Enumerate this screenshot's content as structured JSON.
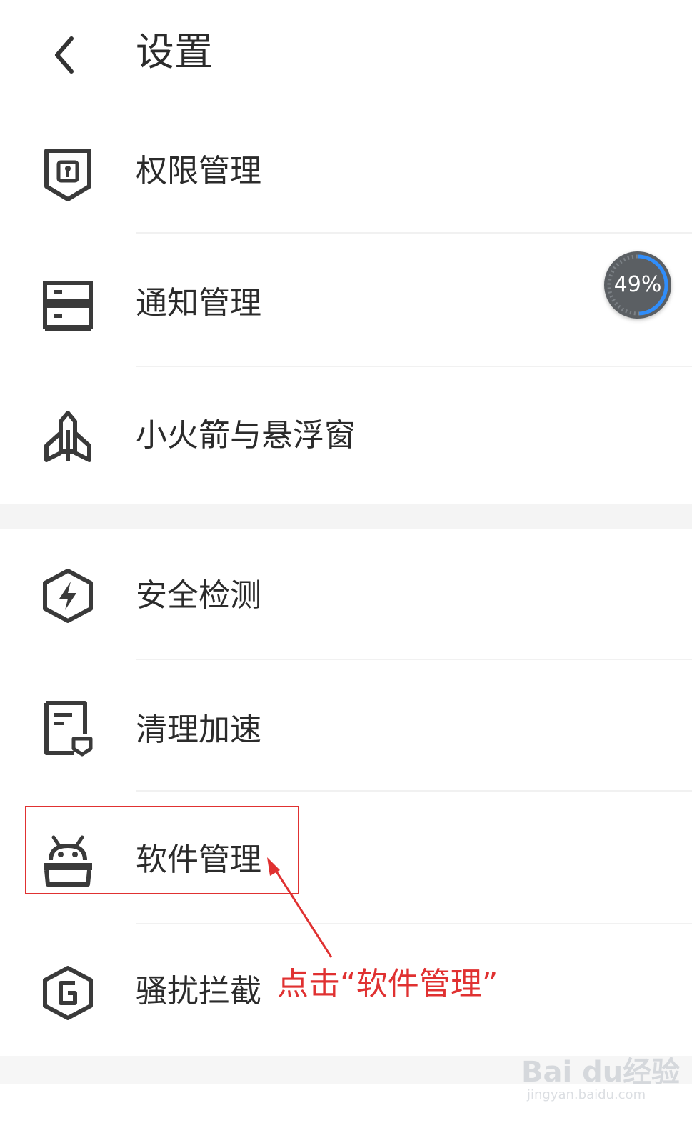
{
  "header": {
    "title": "设置"
  },
  "float_widget": {
    "percent": "49%",
    "progress": 0.49
  },
  "menu": {
    "permission": "权限管理",
    "notification": "通知管理",
    "rocket": "小火箭与悬浮窗",
    "security": "安全检测",
    "cleanup": "清理加速",
    "software": "软件管理",
    "blocking": "骚扰拦截"
  },
  "annotation": {
    "text": "点击“软件管理”",
    "color": "#e03131"
  },
  "watermark": {
    "main": "Bai du经验",
    "sub": "jingyan.baidu.com"
  },
  "colors": {
    "icon": "#3a3a3a",
    "accent_red": "#e03131",
    "widget_bg": "#5b5f63",
    "widget_ring": "#2f8dfb"
  }
}
